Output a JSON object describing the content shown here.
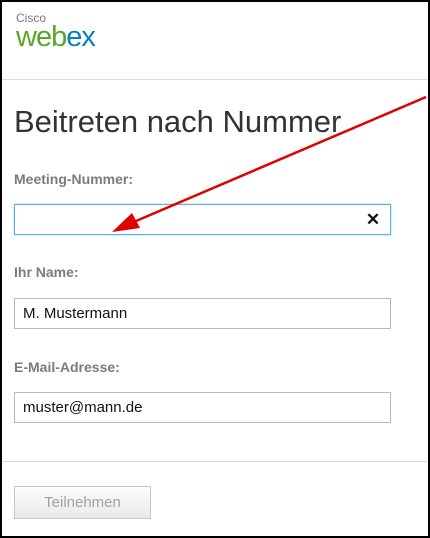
{
  "header": {
    "brand": "Cisco",
    "product_prefix": "web",
    "product_suffix": "ex"
  },
  "page": {
    "title": "Beitreten nach Nummer"
  },
  "form": {
    "meeting_number_label": "Meeting-Nummer:",
    "meeting_number_value": "",
    "clear_symbol": "✕",
    "name_label": "Ihr Name:",
    "name_value": "M. Mustermann",
    "email_label": "E-Mail-Adresse:",
    "email_value": "muster@mann.de",
    "submit_label": "Teilnehmen"
  },
  "icons": {
    "clear": "close-icon",
    "annotation": "red-arrow"
  },
  "colors": {
    "brand_green": "#5aa62a",
    "brand_blue": "#0a7dc4",
    "focus_border": "#5db3e6",
    "annotation_red": "#e00000"
  }
}
